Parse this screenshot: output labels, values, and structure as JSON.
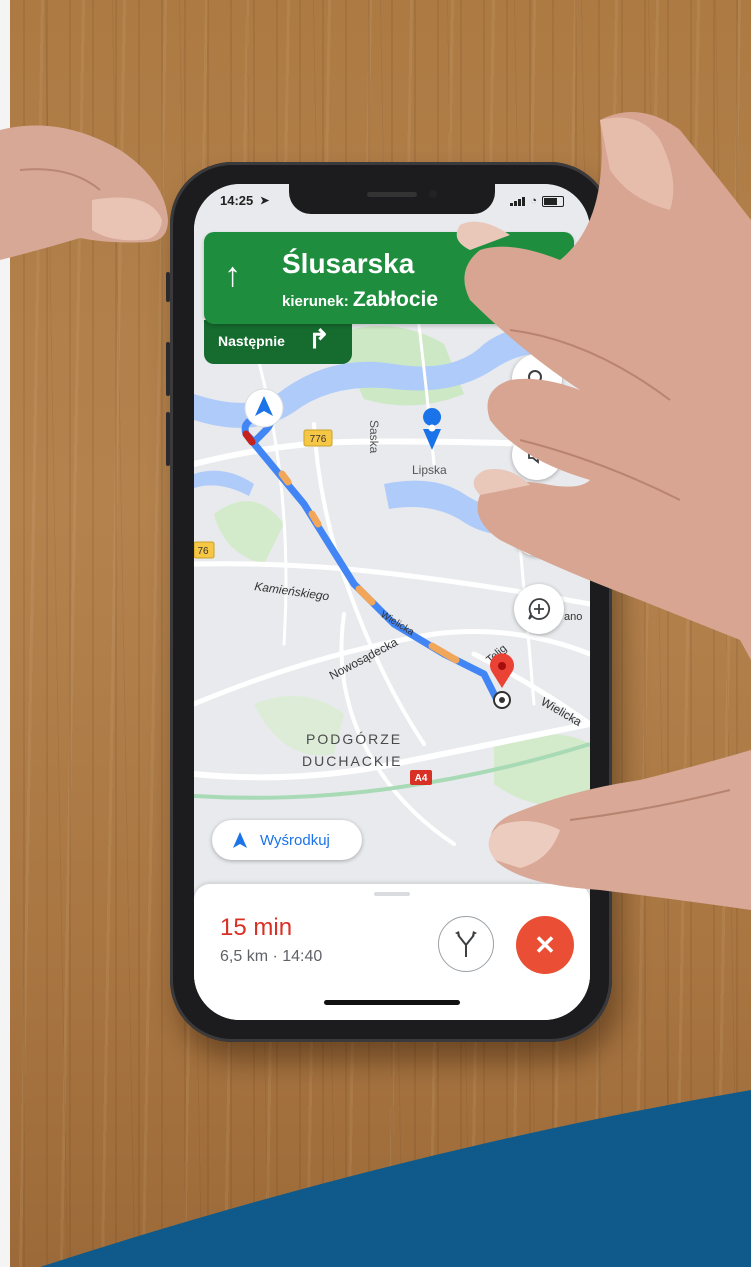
{
  "status_bar": {
    "time": "14:25"
  },
  "navigation": {
    "street": "Ślusarska",
    "direction_prefix": "kierunek:",
    "direction_target": "Zabłocie",
    "next_label": "Następnie"
  },
  "map_labels": {
    "road_776": "776",
    "road_76": "76",
    "saska": "Saska",
    "lipska": "Lipska",
    "kamienskiego": "Kamieńskiego",
    "wielicka_left": "Wielicka",
    "wielicka_right": "Wielicka",
    "nowosadecka": "Nowosądecka",
    "telig": "Telig",
    "podgorze": "PODGÓRZE",
    "duchackie": "DUCHACKIE",
    "a4": "A4",
    "ano": "ano"
  },
  "recenter": {
    "label": "Wyśrodkuj"
  },
  "trip": {
    "eta": "15 min",
    "detail": "6,5 km · 14:40"
  },
  "colors": {
    "nav_green": "#1e8e3e",
    "route_blue": "#4285f4",
    "traffic_orange": "#f2a65a",
    "destination_red": "#ea4335",
    "close_red": "#ea4f35",
    "banner_blue": "#0f5a8a"
  },
  "icons": [
    "straight-arrow-icon",
    "turn-right-icon",
    "search-icon",
    "sound-icon",
    "add-report-icon",
    "navigation-arrow-icon",
    "alternate-routes-icon",
    "close-icon",
    "destination-pin-icon",
    "place-pin-icon"
  ]
}
